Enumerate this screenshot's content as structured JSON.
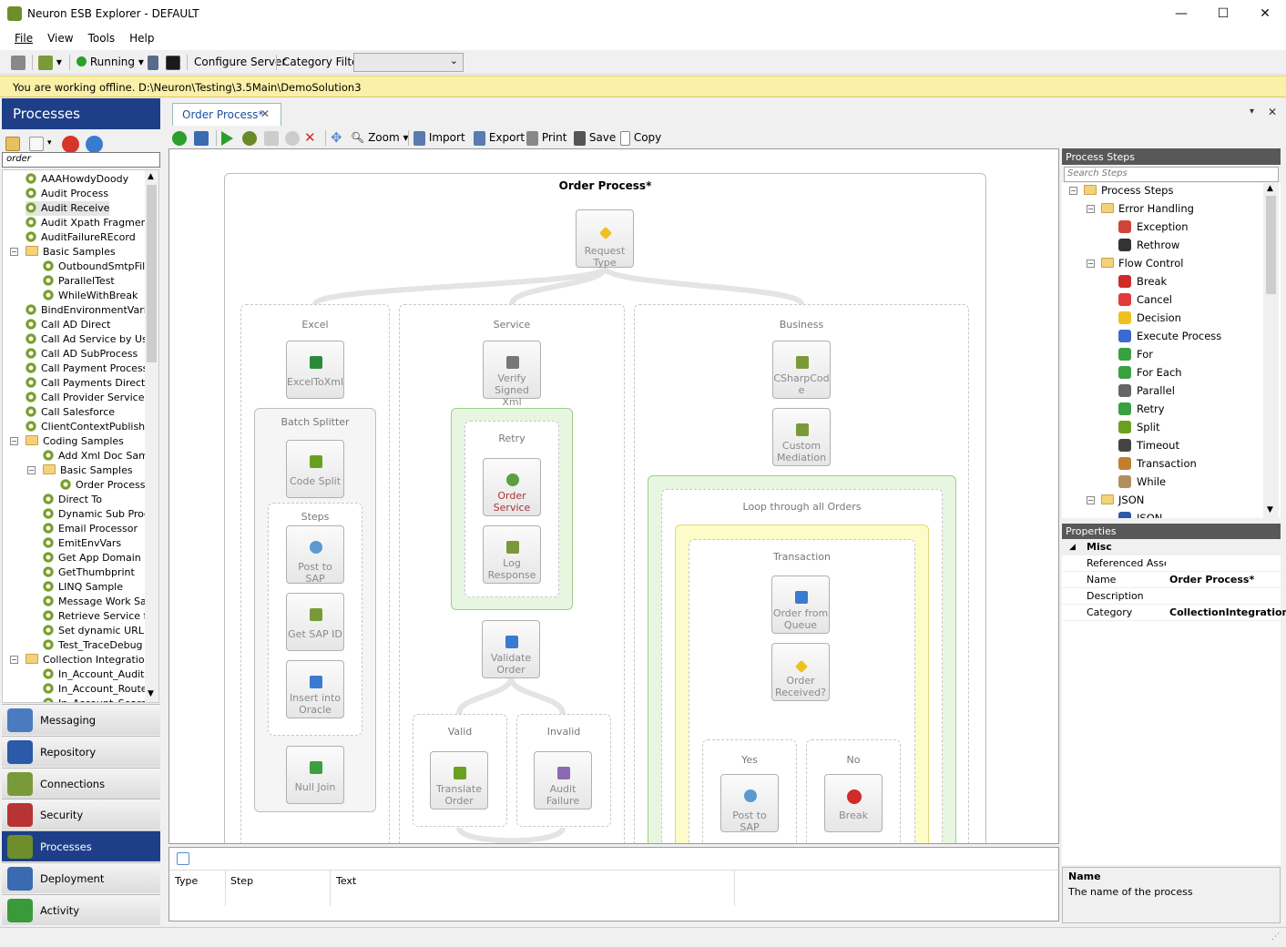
{
  "window": {
    "title": "Neuron ESB Explorer - DEFAULT",
    "minimize": "—",
    "maximize": "☐",
    "close": "✕"
  },
  "menu": [
    "File",
    "View",
    "Tools",
    "Help"
  ],
  "toolbar": {
    "status": "Running",
    "configure": "Configure Server",
    "category_filter": "Category Filter",
    "category_value": ""
  },
  "offline_message": "You are working offline. D:\\Neuron\\Testing\\3.5Main\\DemoSolution3",
  "left": {
    "header": "Processes",
    "search": "order",
    "tree": [
      {
        "label": "AAAHowdyDoody",
        "indent": 0,
        "kind": "gear"
      },
      {
        "label": "Audit Process",
        "indent": 0,
        "kind": "gear"
      },
      {
        "label": "Audit Receive",
        "indent": 0,
        "kind": "gear",
        "selected": true
      },
      {
        "label": "Audit Xpath Fragment",
        "indent": 0,
        "kind": "gear"
      },
      {
        "label": "AuditFailureREcord",
        "indent": 0,
        "kind": "gear"
      },
      {
        "label": "Basic Samples",
        "indent": 0,
        "kind": "folder",
        "exp": "−"
      },
      {
        "label": "OutboundSmtpFileN",
        "indent": 1,
        "kind": "gear"
      },
      {
        "label": "ParallelTest",
        "indent": 1,
        "kind": "gear"
      },
      {
        "label": "WhileWithBreak",
        "indent": 1,
        "kind": "gear"
      },
      {
        "label": "BindEnvironmentVariabl",
        "indent": 0,
        "kind": "gear"
      },
      {
        "label": "Call AD Direct",
        "indent": 0,
        "kind": "gear"
      },
      {
        "label": "Call Ad Service by User",
        "indent": 0,
        "kind": "gear"
      },
      {
        "label": "Call AD SubProcess",
        "indent": 0,
        "kind": "gear"
      },
      {
        "label": "Call Payment Processor",
        "indent": 0,
        "kind": "gear"
      },
      {
        "label": "Call Payments Directly",
        "indent": 0,
        "kind": "gear"
      },
      {
        "label": "Call Provider Services",
        "indent": 0,
        "kind": "gear"
      },
      {
        "label": "Call Salesforce",
        "indent": 0,
        "kind": "gear"
      },
      {
        "label": "ClientContextPublishTo",
        "indent": 0,
        "kind": "gear"
      },
      {
        "label": "Coding Samples",
        "indent": 0,
        "kind": "folder",
        "exp": "−"
      },
      {
        "label": "Add Xml Doc Sample",
        "indent": 1,
        "kind": "gear"
      },
      {
        "label": "Basic Samples",
        "indent": 1,
        "kind": "folder",
        "exp": "−"
      },
      {
        "label": "Order Process",
        "indent": 2,
        "kind": "gear"
      },
      {
        "label": "Direct To",
        "indent": 1,
        "kind": "gear"
      },
      {
        "label": "Dynamic Sub Proces",
        "indent": 1,
        "kind": "gear"
      },
      {
        "label": "Email Processor",
        "indent": 1,
        "kind": "gear"
      },
      {
        "label": "EmitEnvVars",
        "indent": 1,
        "kind": "gear"
      },
      {
        "label": "Get App Domain",
        "indent": 1,
        "kind": "gear"
      },
      {
        "label": "GetThumbprint",
        "indent": 1,
        "kind": "gear"
      },
      {
        "label": "LINQ Sample",
        "indent": 1,
        "kind": "gear"
      },
      {
        "label": "Message Work Sam",
        "indent": 1,
        "kind": "gear"
      },
      {
        "label": "Retrieve Service fro",
        "indent": 1,
        "kind": "gear"
      },
      {
        "label": "Set dynamic URL",
        "indent": 1,
        "kind": "gear"
      },
      {
        "label": "Test_TraceDebug",
        "indent": 1,
        "kind": "gear"
      },
      {
        "label": "Collection Integration",
        "indent": 0,
        "kind": "folder",
        "exp": "−"
      },
      {
        "label": "In_Account_Audit",
        "indent": 1,
        "kind": "gear"
      },
      {
        "label": "In_Account_Router",
        "indent": 1,
        "kind": "gear"
      },
      {
        "label": "In_Account_SearchI",
        "indent": 1,
        "kind": "gear"
      }
    ],
    "nav": [
      {
        "label": "Messaging",
        "color": "#4a7bbf"
      },
      {
        "label": "Repository",
        "color": "#2a5aa8"
      },
      {
        "label": "Connections",
        "color": "#7a9a3a"
      },
      {
        "label": "Security",
        "color": "#b83434"
      },
      {
        "label": "Processes",
        "color": "#6d8e2a",
        "selected": true
      },
      {
        "label": "Deployment",
        "color": "#3a6ab0"
      },
      {
        "label": "Activity",
        "color": "#3a9a3a"
      }
    ]
  },
  "document": {
    "tab": "Order Process*",
    "tools": {
      "zoom": "Zoom",
      "import": "Import",
      "export": "Export",
      "print": "Print",
      "save": "Save",
      "copy": "Copy"
    },
    "diagram": {
      "title": "Order Process*",
      "request": "Request Type",
      "branches": {
        "excel": "Excel",
        "service": "Service",
        "business": "Business"
      },
      "excel_to_xml": "ExcelToXml",
      "batch_splitter": "Batch Splitter",
      "code_split": "Code Split",
      "steps": "Steps",
      "post_to_sap": "Post to SAP",
      "get_sap_id": "Get SAP ID",
      "insert_oracle": "Insert into Oracle",
      "null_join": "Null Join",
      "verify": "Verify Signed Xml",
      "retry": "Retry",
      "order_service": "Order Service",
      "log_response": "Log Response",
      "validate": "Validate Order",
      "valid": "Valid",
      "invalid": "Invalid",
      "translate": "Translate Order",
      "audit_failure": "Audit Failure",
      "csharp": "CSharpCode",
      "custom": "Custom Mediation",
      "loop": "Loop through all Orders",
      "transaction": "Transaction",
      "order_queue": "Order from Queue",
      "order_received": "Order Received?",
      "yes": "Yes",
      "no": "No",
      "post_sap2": "Post to SAP",
      "break": "Break"
    }
  },
  "log": {
    "columns": [
      "Type",
      "Step",
      "Text"
    ]
  },
  "process_steps": {
    "header": "Process Steps",
    "search": "Search Steps",
    "items": [
      {
        "label": "Process Steps",
        "indent": 0,
        "kind": "folder",
        "exp": "−"
      },
      {
        "label": "Error Handling",
        "indent": 1,
        "kind": "folder",
        "exp": "−"
      },
      {
        "label": "Exception",
        "indent": 2,
        "color": "#d0453a"
      },
      {
        "label": "Rethrow",
        "indent": 2,
        "color": "#333"
      },
      {
        "label": "Flow Control",
        "indent": 1,
        "kind": "folder",
        "exp": "−"
      },
      {
        "label": "Break",
        "indent": 2,
        "color": "#d02a2a"
      },
      {
        "label": "Cancel",
        "indent": 2,
        "color": "#e03a3a"
      },
      {
        "label": "Decision",
        "indent": 2,
        "color": "#f0c020"
      },
      {
        "label": "Execute Process",
        "indent": 2,
        "color": "#3a6ad0"
      },
      {
        "label": "For",
        "indent": 2,
        "color": "#3aa040"
      },
      {
        "label": "For Each",
        "indent": 2,
        "color": "#3aa040"
      },
      {
        "label": "Parallel",
        "indent": 2,
        "color": "#666"
      },
      {
        "label": "Retry",
        "indent": 2,
        "color": "#3aa040"
      },
      {
        "label": "Split",
        "indent": 2,
        "color": "#6aa020"
      },
      {
        "label": "Timeout",
        "indent": 2,
        "color": "#444"
      },
      {
        "label": "Transaction",
        "indent": 2,
        "color": "#c08030"
      },
      {
        "label": "While",
        "indent": 2,
        "color": "#b09060"
      },
      {
        "label": "JSON",
        "indent": 1,
        "kind": "folder",
        "exp": "−"
      },
      {
        "label": "JSON",
        "indent": 2,
        "color": "#2a5aa8"
      }
    ]
  },
  "properties": {
    "header": "Properties",
    "section": "Misc",
    "rows": [
      {
        "key": "Referenced Assemblies",
        "value": ""
      },
      {
        "key": "Name",
        "value": "Order Process*"
      },
      {
        "key": "Description",
        "value": ""
      },
      {
        "key": "Category",
        "value": "CollectionIntegration"
      }
    ],
    "desc_title": "Name",
    "desc_text": "The name of the process"
  }
}
